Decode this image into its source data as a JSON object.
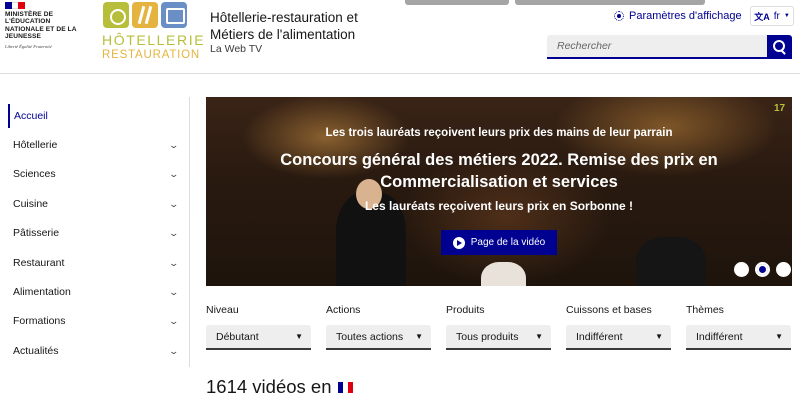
{
  "header": {
    "ministry": "Ministère de l'éducation nationale et de la jeunesse",
    "devise": "Liberté Égalité Fraternité",
    "brand_line1": "HÔTELLERIE",
    "brand_line2": "RESTAURATION",
    "service_title": "Hôtellerie-restauration et Métiers de l'alimentation",
    "service_tagline": "La Web TV",
    "display_settings": "Paramètres d'affichage",
    "language": "fr",
    "search_placeholder": "Rechercher"
  },
  "sidebar": {
    "items": [
      {
        "label": "Accueil",
        "active": true
      },
      {
        "label": "Hôtellerie"
      },
      {
        "label": "Sciences"
      },
      {
        "label": "Cuisine"
      },
      {
        "label": "Pâtisserie"
      },
      {
        "label": "Restaurant"
      },
      {
        "label": "Alimentation"
      },
      {
        "label": "Formations"
      },
      {
        "label": "Actualités"
      }
    ]
  },
  "hero": {
    "kicker": "Les trois lauréats reçoivent leurs prix des mains de leur parrain",
    "title": "Concours général des métiers 2022. Remise des prix en Commercialisation et services",
    "subtitle": "Les lauréats reçoivent leurs prix en Sorbonne !",
    "button_label": "Page de la vidéo",
    "slides": 3,
    "active_slide": 2
  },
  "filters": [
    {
      "label": "Niveau",
      "value": "Débutant"
    },
    {
      "label": "Actions",
      "value": "Toutes actions"
    },
    {
      "label": "Produits",
      "value": "Tous produits"
    },
    {
      "label": "Cuissons et bases",
      "value": "Indifférent"
    },
    {
      "label": "Thèmes",
      "value": "Indifférent"
    }
  ],
  "results": {
    "count_text": "1614 vidéos en"
  },
  "colors": {
    "primary": "#000091",
    "brand_green": "#b7bf3a",
    "brand_gold": "#e5b440"
  }
}
